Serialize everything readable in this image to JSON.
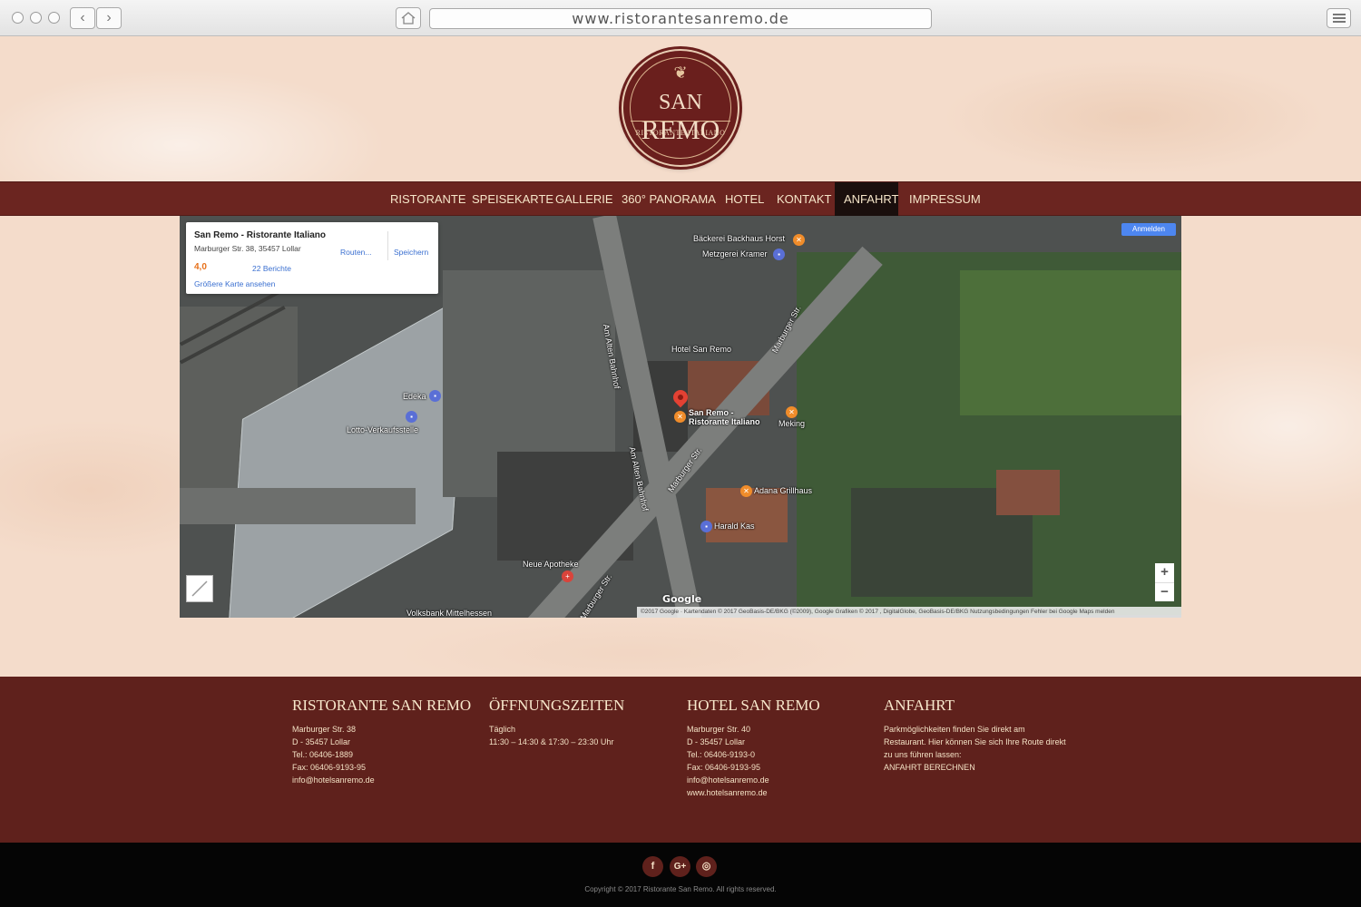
{
  "browser": {
    "url": "www.ristorantesanremo.de",
    "back_icon": "chevron-left-icon",
    "forward_icon": "chevron-right-icon"
  },
  "logo": {
    "ornament": "❦",
    "name_first": "SAN",
    "name_second": "REMO",
    "subtitle": "RISTORANTE ITALIANO"
  },
  "nav": {
    "items": [
      {
        "label": "RISTORANTE",
        "active": false
      },
      {
        "label": "SPEISEKARTE",
        "active": false
      },
      {
        "label": "GALLERIE",
        "active": false
      },
      {
        "label": "360° PANORAMA",
        "active": false
      },
      {
        "label": "HOTEL",
        "active": false
      },
      {
        "label": "KONTAKT",
        "active": false
      },
      {
        "label": "ANFAHRT",
        "active": true
      },
      {
        "label": "IMPRESSUM",
        "active": false
      }
    ]
  },
  "map": {
    "card": {
      "title": "San Remo - Ristorante Italiano",
      "address": "Marburger Str. 38, 35457 Lollar",
      "route": "Routen...",
      "save": "Speichern",
      "rating": "4,0",
      "reviews": "22 Berichte",
      "larger_map": "Größere Karte ansehen"
    },
    "signin": "Anmelden",
    "zoom_in": "+",
    "zoom_out": "−",
    "labels": {
      "backhaus": "Bäckerei Backhaus Horst",
      "kramer": "Metzgerei Kramer",
      "hotel": "Hotel San Remo",
      "edeka": "Edeka",
      "lotto": "Lotto-Verkaufsstelle",
      "sanremo": "San Remo -",
      "sanremo2": "Ristorante Italiano",
      "meking": "Meking",
      "adana": "Adana Grillhaus",
      "harald": "Harald Kas",
      "apotheke": "Neue Apotheke",
      "volksbank": "Volksbank Mittelhessen",
      "marburger1": "Marburger Str.",
      "marburger2": "Marburger Str.",
      "marburger3": "Marburger Str.",
      "alten1": "Am Alten Bahnhof",
      "alten2": "Am Alten Bahnhof"
    },
    "google": "Google",
    "attribution": "©2017 Google · Kartendaten © 2017 GeoBasis-DE/BKG (©2009), Google Grafiken © 2017 , DigitalGlobe, GeoBasis-DE/BKG    Nutzungsbedingungen    Fehler bei Google Maps melden"
  },
  "footer": {
    "ristorante": {
      "title": "RISTORANTE SAN REMO",
      "lines": [
        "Marburger Str. 38",
        "D - 35457 Lollar",
        "Tel.: 06406-1889",
        "Fax: 06406-9193-95",
        "info@hotelsanremo.de"
      ]
    },
    "hours": {
      "title": "ÖFFNUNGSZEITEN",
      "lines": [
        "Täglich",
        "11:30 – 14:30 & 17:30 – 23:30 Uhr"
      ]
    },
    "hotel": {
      "title": "HOTEL SAN REMO",
      "lines": [
        "Marburger Str. 40",
        "D - 35457 Lollar",
        "Tel.: 06406-9193-0",
        "Fax: 06406-9193-95",
        "info@hotelsanremo.de",
        "www.hotelsanremo.de"
      ]
    },
    "anfahrt": {
      "title": "ANFAHRT",
      "lines": [
        "Parkmöglichkeiten finden Sie direkt am",
        "Restaurant. Hier können Sie sich Ihre Route direkt",
        "zu uns führen lassen:",
        "ANFAHRT BERECHNEN"
      ]
    }
  },
  "social": {
    "facebook": "f",
    "googleplus": "G+",
    "tripadvisor": "◎"
  },
  "copyright": "Copyright © 2017 Ristorante San Remo. All rights reserved.",
  "colors": {
    "brand": "#6b2520",
    "footer": "#5f211c",
    "nav_text": "#f6e6c9",
    "active": "#1a0f0d"
  }
}
